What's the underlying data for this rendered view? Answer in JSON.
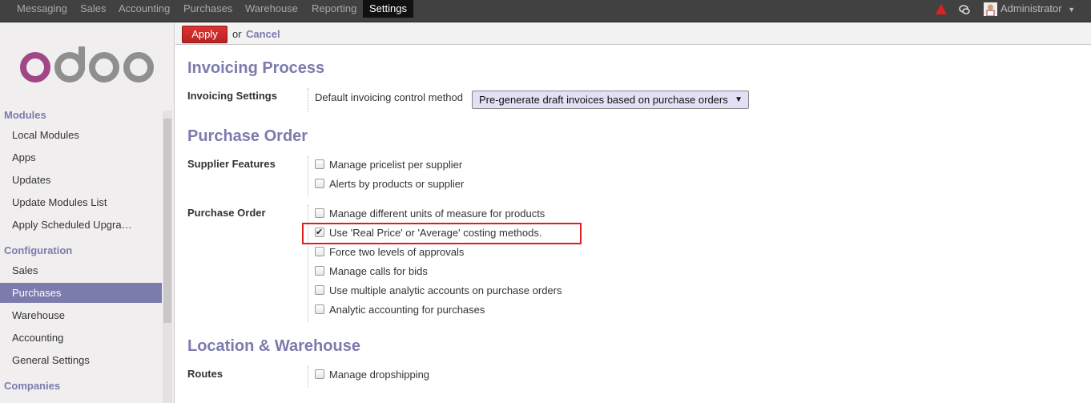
{
  "topbar": {
    "nav": [
      "Messaging",
      "Sales",
      "Accounting",
      "Purchases",
      "Warehouse",
      "Reporting",
      "Settings"
    ],
    "active": "Settings",
    "user": "Administrator"
  },
  "sidebar": {
    "logo_text": "odoo",
    "sections": [
      {
        "header": "Modules",
        "items": [
          "Local Modules",
          "Apps",
          "Updates",
          "Update Modules List",
          "Apply Scheduled Upgra…"
        ]
      },
      {
        "header": "Configuration",
        "items": [
          "Sales",
          "Purchases",
          "Warehouse",
          "Accounting",
          "General Settings"
        ]
      },
      {
        "header": "Companies",
        "items": []
      }
    ],
    "active_item": "Purchases"
  },
  "actionbar": {
    "apply": "Apply",
    "or": "or",
    "cancel": "Cancel"
  },
  "sections": [
    {
      "title": "Invoicing Process",
      "rows": [
        {
          "label": "Invoicing Settings",
          "field_label": "Default invoicing control method",
          "select_value": "Pre-generate draft invoices based on purchase orders"
        }
      ]
    },
    {
      "title": "Purchase Order",
      "rows": [
        {
          "label": "Supplier Features",
          "options": [
            {
              "text": "Manage pricelist per supplier",
              "checked": false
            },
            {
              "text": "Alerts by products or supplier",
              "checked": false
            }
          ]
        },
        {
          "label": "Purchase Order",
          "options": [
            {
              "text": "Manage different units of measure for products",
              "checked": false
            },
            {
              "text": "Use 'Real Price' or 'Average' costing methods.",
              "checked": true
            },
            {
              "text": "Force two levels of approvals",
              "checked": false
            },
            {
              "text": "Manage calls for bids",
              "checked": false
            },
            {
              "text": "Use multiple analytic accounts on purchase orders",
              "checked": false
            },
            {
              "text": "Analytic accounting for purchases",
              "checked": false
            }
          ]
        }
      ]
    },
    {
      "title": "Location & Warehouse",
      "rows": [
        {
          "label": "Routes",
          "options": [
            {
              "text": "Manage dropshipping",
              "checked": false
            }
          ]
        }
      ]
    }
  ],
  "colors": {
    "accent": "#7c7bad",
    "apply": "#c42b2b",
    "highlight": "#e01e1e"
  }
}
